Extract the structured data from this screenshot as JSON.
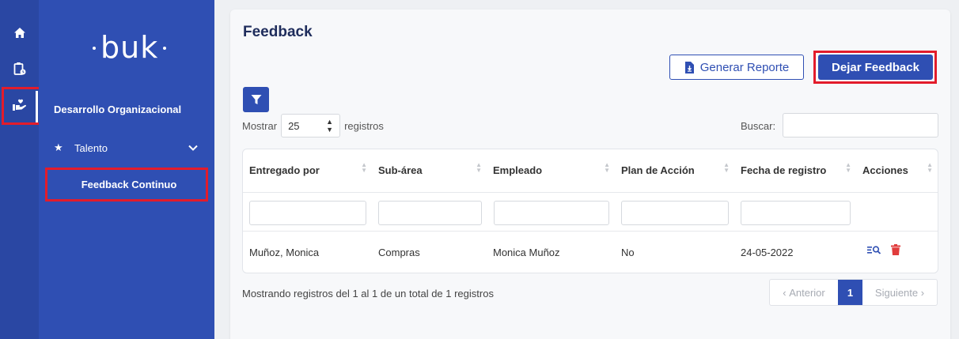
{
  "brand": {
    "logo_text": "buk"
  },
  "rail": {
    "items": [
      {
        "icon": "home-icon"
      },
      {
        "icon": "clipboard-clock-icon"
      },
      {
        "icon": "hand-heart-icon"
      }
    ]
  },
  "sidebar": {
    "module_title": "Desarrollo Organizacional",
    "section_label": "Talento",
    "active_item": "Feedback Continuo"
  },
  "page": {
    "title": "Feedback"
  },
  "toolbar": {
    "report_label": "Generar Reporte",
    "feedback_label": "Dejar Feedback"
  },
  "list_controls": {
    "show_label": "Mostrar",
    "length_value": "25",
    "records_label": "registros",
    "search_label": "Buscar:",
    "search_value": ""
  },
  "table": {
    "columns": [
      "Entregado por",
      "Sub-área",
      "Empleado",
      "Plan de Acción",
      "Fecha de registro",
      "Acciones"
    ],
    "rows": [
      {
        "entregado_por": "Muñoz, Monica",
        "sub_area": "Compras",
        "empleado": "Monica Muñoz",
        "plan_accion": "No",
        "fecha": "24-05-2022"
      }
    ]
  },
  "footer": {
    "info": "Mostrando registros del 1 al 1 de un total de 1 registros",
    "prev_label": "Anterior",
    "page": "1",
    "next_label": "Siguiente"
  },
  "colors": {
    "rail": "#2a47a3",
    "sidebar": "#2f4fb3",
    "primary": "#2f4fb3",
    "highlight": "#e31c2b",
    "danger": "#e03c3c"
  }
}
